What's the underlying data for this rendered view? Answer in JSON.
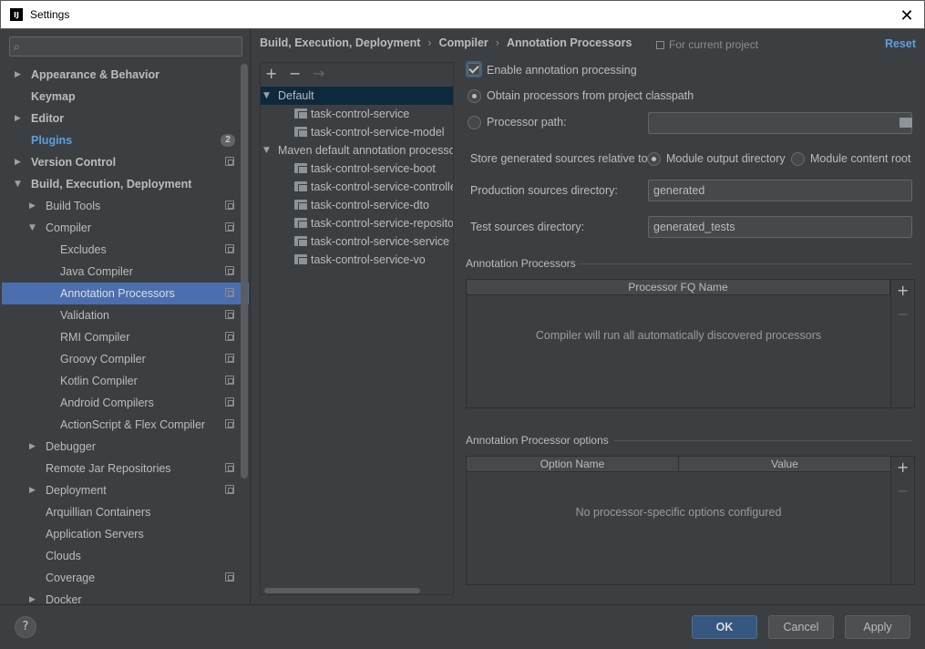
{
  "window": {
    "title": "Settings",
    "app_icon": "intellij-icon",
    "close_glyph": "✕"
  },
  "search": {
    "placeholder": ""
  },
  "sidebar": {
    "items": [
      {
        "label": "Appearance & Behavior",
        "expandable": true
      },
      {
        "label": "Keymap"
      },
      {
        "label": "Editor",
        "expandable": true
      },
      {
        "label": "Plugins",
        "badge": "2"
      },
      {
        "label": "Version Control",
        "expandable": true
      },
      {
        "label": "Build, Execution, Deployment",
        "expanded": true
      },
      {
        "label": "Build Tools",
        "expandable": true
      },
      {
        "label": "Compiler",
        "expanded": true
      },
      {
        "label": "Excludes"
      },
      {
        "label": "Java Compiler"
      },
      {
        "label": "Annotation Processors",
        "selected": true
      },
      {
        "label": "Validation"
      },
      {
        "label": "RMI Compiler"
      },
      {
        "label": "Groovy Compiler"
      },
      {
        "label": "Kotlin Compiler"
      },
      {
        "label": "Android Compilers"
      },
      {
        "label": "ActionScript & Flex Compiler"
      },
      {
        "label": "Debugger",
        "expandable": true
      },
      {
        "label": "Remote Jar Repositories"
      },
      {
        "label": "Deployment",
        "expandable": true
      },
      {
        "label": "Arquillian Containers"
      },
      {
        "label": "Application Servers"
      },
      {
        "label": "Clouds"
      },
      {
        "label": "Coverage"
      },
      {
        "label": "Docker",
        "expandable": true
      }
    ]
  },
  "breadcrumb": {
    "parts": [
      "Build, Execution, Deployment",
      "Compiler",
      "Annotation Processors"
    ],
    "separator": "›"
  },
  "scope": {
    "label": "For current project"
  },
  "reset_label": "Reset",
  "profiles": {
    "toolbar": {
      "add": "+",
      "remove": "−",
      "move": "→"
    },
    "items": [
      {
        "label": "Default",
        "group": true
      },
      {
        "label": "task-control-service"
      },
      {
        "label": "task-control-service-model"
      },
      {
        "label": "Maven default annotation processors",
        "group": true
      },
      {
        "label": "task-control-service-boot"
      },
      {
        "label": "task-control-service-controller"
      },
      {
        "label": "task-control-service-dto"
      },
      {
        "label": "task-control-service-repository"
      },
      {
        "label": "task-control-service-service"
      },
      {
        "label": "task-control-service-vo"
      }
    ]
  },
  "form": {
    "enable_label": "Enable annotation processing",
    "obtain_label": "Obtain processors from project classpath",
    "processor_path_label": "Processor path:",
    "processor_path_value": "",
    "store_label": "Store generated sources relative to:",
    "module_output_label": "Module output directory",
    "module_content_label": "Module content root",
    "production_label": "Production sources directory:",
    "production_value": "generated",
    "test_label": "Test sources directory:",
    "test_value": "generated_tests"
  },
  "processors_section": {
    "title": "Annotation Processors",
    "column": "Processor FQ Name",
    "empty": "Compiler will run all automatically discovered processors"
  },
  "options_section": {
    "title": "Annotation Processor options",
    "columns": [
      "Option Name",
      "Value"
    ],
    "empty": "No processor-specific options configured"
  },
  "footer": {
    "help": "?",
    "ok": "OK",
    "cancel": "Cancel",
    "apply": "Apply"
  },
  "colors": {
    "accent": "#4b6eaf",
    "link": "#5c9fe3",
    "background": "#3c3f41",
    "ok_button": "#365880"
  }
}
